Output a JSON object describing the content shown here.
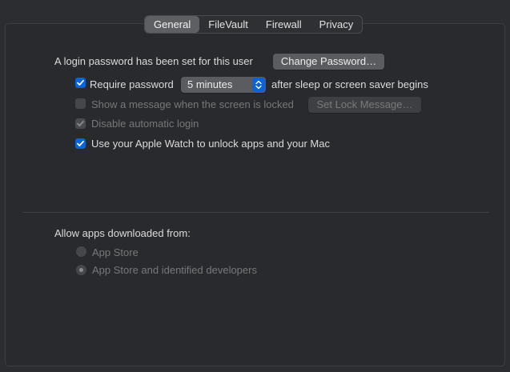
{
  "tabs": [
    {
      "label": "General",
      "selected": true
    },
    {
      "label": "FileVault",
      "selected": false
    },
    {
      "label": "Firewall",
      "selected": false
    },
    {
      "label": "Privacy",
      "selected": false
    }
  ],
  "login": {
    "status_text": "A login password has been set for this user",
    "change_password_label": "Change Password…"
  },
  "require_password": {
    "checked": true,
    "label_before": "Require password",
    "selected_value": "5 minutes",
    "label_after": "after sleep or screen saver begins"
  },
  "show_message": {
    "checked": false,
    "enabled": false,
    "label": "Show a message when the screen is locked",
    "button_label": "Set Lock Message…"
  },
  "disable_auto_login": {
    "checked": true,
    "enabled": false,
    "label": "Disable automatic login"
  },
  "apple_watch": {
    "checked": true,
    "label": "Use your Apple Watch to unlock apps and your Mac"
  },
  "allow_apps": {
    "heading": "Allow apps downloaded from:",
    "options": [
      {
        "label": "App Store",
        "selected": false,
        "enabled": false
      },
      {
        "label": "App Store and identified developers",
        "selected": true,
        "enabled": false
      }
    ]
  },
  "colors": {
    "accent": "#0a63d7",
    "background": "#2c2d30"
  }
}
